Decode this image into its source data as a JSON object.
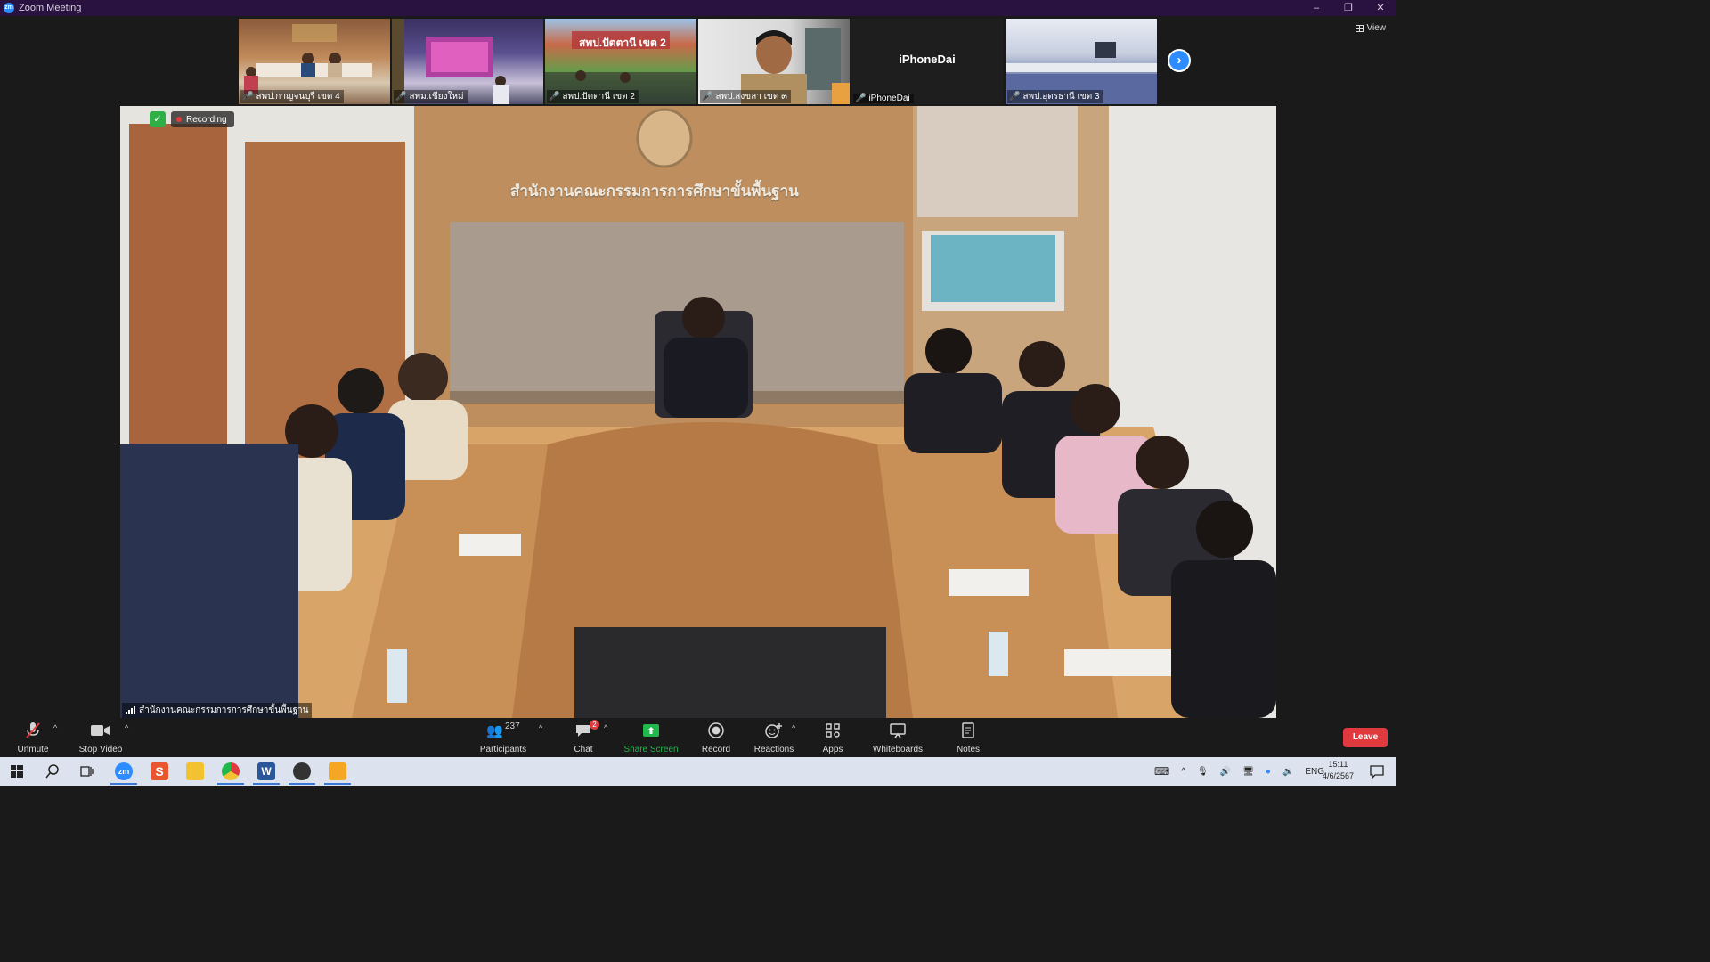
{
  "window": {
    "title": "Zoom Meeting",
    "controls": [
      "–",
      "❐",
      "✕"
    ]
  },
  "gallery": {
    "thumbnails": [
      {
        "name": "สพป.กาญจนบุรี เขต 4"
      },
      {
        "name": "สพม.เชียงใหม่"
      },
      {
        "name": "สพป.ปัตตานี เขต 2",
        "overlay_text": "สพป.ปัตตานี เขต 2"
      },
      {
        "name": "สพป.สงขลา เขต ๓"
      },
      {
        "name": "iPhoneDai",
        "big_name": "iPhoneDai"
      },
      {
        "name": "สพป.อุดรธานี เขต 3"
      }
    ],
    "view_label": "View"
  },
  "main_video": {
    "recording_label": "Recording",
    "speaker_name": "สำนักงานคณะกรรมการการศึกษาขั้นพื้นฐาน",
    "wall_sign": "สำนักงานคณะกรรมการการศึกษาขั้นพื้นฐาน"
  },
  "toolbar": {
    "unmute": "Unmute",
    "stop_video": "Stop Video",
    "participants": "Participants",
    "participants_count": "237",
    "chat": "Chat",
    "chat_badge": "2",
    "share_screen": "Share Screen",
    "record": "Record",
    "reactions": "Reactions",
    "apps": "Apps",
    "whiteboards": "Whiteboards",
    "notes": "Notes",
    "leave": "Leave"
  },
  "taskbar": {
    "language": "ENG",
    "time": "15:11",
    "date": "4/6/2567"
  },
  "colors": {
    "accent": "#2d8cff",
    "leave": "#e0393e",
    "share": "#1fb84a",
    "titlebar": "#29123f"
  }
}
